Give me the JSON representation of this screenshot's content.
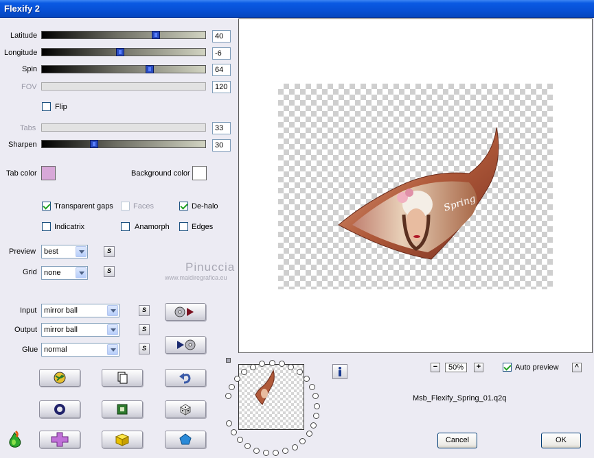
{
  "window": {
    "title": "Flexify 2"
  },
  "sliders": [
    {
      "label": "Latitude",
      "value": "40",
      "level": 0.71,
      "enabled": true
    },
    {
      "label": "Longitude",
      "value": "-6",
      "level": 0.48,
      "enabled": true
    },
    {
      "label": "Spin",
      "value": "64",
      "level": 0.67,
      "enabled": true
    },
    {
      "label": "FOV",
      "value": "120",
      "enabled": false
    },
    {
      "label": "Tabs",
      "value": "33",
      "enabled": false
    },
    {
      "label": "Sharpen",
      "value": "30",
      "level": 0.31,
      "enabled": true
    }
  ],
  "flip": {
    "label": "Flip",
    "checked": false
  },
  "colors": {
    "tab_color_label": "Tab color",
    "tab_color": "#d8a8d8",
    "background_color_label": "Background color",
    "background_color": "#ffffff"
  },
  "options": {
    "transparent_gaps": {
      "label": "Transparent gaps",
      "checked": true
    },
    "faces": {
      "label": "Faces",
      "checked": false
    },
    "de_halo": {
      "label": "De-halo",
      "checked": true
    },
    "indicatrix": {
      "label": "Indicatrix",
      "checked": false
    },
    "anamorph": {
      "label": "Anamorph",
      "checked": false
    },
    "edges": {
      "label": "Edges",
      "checked": false
    }
  },
  "dropdowns": {
    "preview": {
      "label": "Preview",
      "value": "best"
    },
    "grid": {
      "label": "Grid",
      "value": "none"
    },
    "input": {
      "label": "Input",
      "value": "mirror ball"
    },
    "output": {
      "label": "Output",
      "value": "mirror ball"
    },
    "glue": {
      "label": "Glue",
      "value": "normal"
    }
  },
  "save_button_label": "S",
  "watermark": {
    "line1": "Pinuccia",
    "line2": "www.maidiregrafica.eu"
  },
  "preview": {
    "zoom": "50%",
    "auto_preview_label": "Auto preview",
    "auto_preview_checked": true,
    "filename": "Msb_Flexify_Spring_01.q2q",
    "image_text": "Spring"
  },
  "buttons": {
    "cancel": "Cancel",
    "ok": "OK",
    "zoom_out": "−",
    "zoom_in": "+",
    "collapse": "^"
  }
}
